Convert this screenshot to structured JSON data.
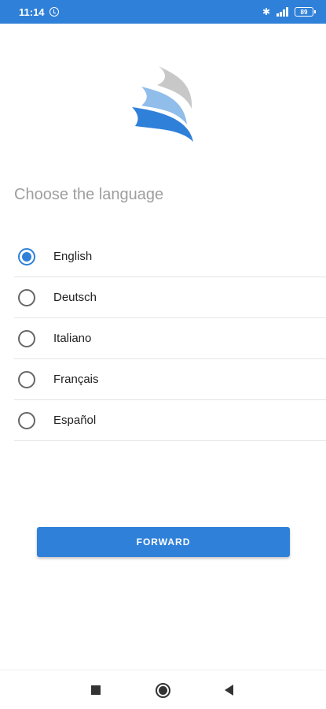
{
  "status_bar": {
    "time": "11:14",
    "battery": "89",
    "icons": [
      "alarm-icon",
      "bluetooth-icon",
      "signal-icon",
      "battery-icon"
    ]
  },
  "logo": {
    "icon": "wave-logo-icon",
    "colors": [
      "#c8c8c8",
      "#90bdea",
      "#2f80d9"
    ]
  },
  "title": "Choose the language",
  "languages": [
    {
      "label": "English",
      "selected": true
    },
    {
      "label": "Deutsch",
      "selected": false
    },
    {
      "label": "Italiano",
      "selected": false
    },
    {
      "label": "Français",
      "selected": false
    },
    {
      "label": "Español",
      "selected": false
    }
  ],
  "forward_button": {
    "label": "FORWARD"
  },
  "nav_bar": {
    "icons": [
      "recents-icon",
      "home-icon",
      "back-icon"
    ]
  },
  "colors": {
    "accent": "#2f80d9",
    "title_text": "#9e9e9e",
    "divider": "#e4e4e4"
  }
}
